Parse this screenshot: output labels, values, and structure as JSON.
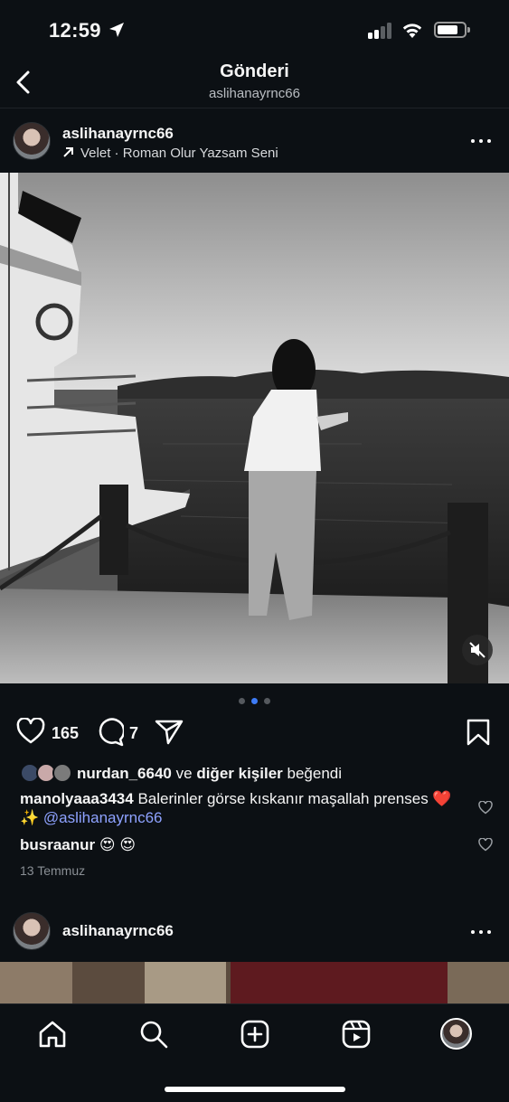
{
  "status_bar": {
    "time": "12:59"
  },
  "header": {
    "title": "Gönderi",
    "subtitle": "aslihanayrnc66"
  },
  "post": {
    "username": "aslihanayrnc66",
    "music": "Velet · Roman Olur Yazsam Seni",
    "like_count": "165",
    "comment_count": "7",
    "carousel": {
      "total": 3,
      "active_index": 1
    },
    "liked_by": {
      "user": "nurdan_6640",
      "connector": "ve",
      "others": "diğer kişiler",
      "suffix": "beğendi"
    },
    "comments": [
      {
        "user": "manolyaaa3434",
        "text": "Balerinler görse kıskanır maşallah prenses ❤️ ✨",
        "mention": "@aslihanayrnc66"
      },
      {
        "user": "busraanur",
        "text": "😍 😍"
      }
    ],
    "date": "13 Temmuz"
  },
  "next_post": {
    "username": "aslihanayrnc66"
  },
  "colors": {
    "background": "#0c1014",
    "accent": "#3d7bf5",
    "mention": "#8ea2ff"
  }
}
